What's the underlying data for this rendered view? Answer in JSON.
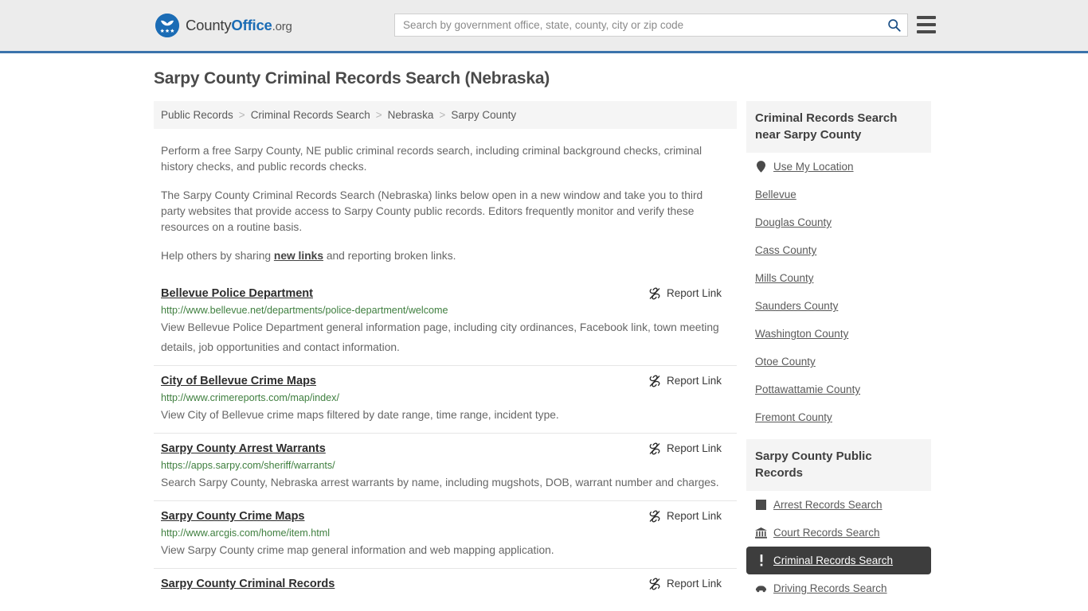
{
  "header": {
    "logo_text_part1": "County",
    "logo_text_part2": "Office",
    "logo_text_part3": ".org",
    "search_placeholder": "Search by government office, state, county, city or zip code",
    "search_value": "",
    "search_icon": "search-icon",
    "menu_icon": "hamburger-menu-icon"
  },
  "page_title": "Sarpy County Criminal Records Search (Nebraska)",
  "breadcrumb": {
    "separator": ">",
    "items": [
      {
        "label": "Public Records"
      },
      {
        "label": "Criminal Records Search"
      },
      {
        "label": "Nebraska"
      },
      {
        "label": "Sarpy County"
      }
    ]
  },
  "intro": {
    "p1": "Perform a free Sarpy County, NE public criminal records search, including criminal background checks, criminal history checks, and public records checks.",
    "p2": "The Sarpy County Criminal Records Search (Nebraska) links below open in a new window and take you to third party websites that provide access to Sarpy County public records. Editors frequently monitor and verify these resources on a routine basis.",
    "p3_before": "Help others by sharing ",
    "p3_link": "new links",
    "p3_after": " and reporting broken links."
  },
  "report_link_label": "Report Link",
  "report_link_icon": "broken-link-icon",
  "results": [
    {
      "title": "Bellevue Police Department",
      "url": "http://www.bellevue.net/departments/police-department/welcome",
      "description": "View Bellevue Police Department general information page, including city ordinances, Facebook link, town meeting details, job opportunities and contact information."
    },
    {
      "title": "City of Bellevue Crime Maps",
      "url": "http://www.crimereports.com/map/index/",
      "description": "View City of Bellevue crime maps filtered by date range, time range, incident type."
    },
    {
      "title": "Sarpy County Arrest Warrants",
      "url": "https://apps.sarpy.com/sheriff/warrants/",
      "description": "Search Sarpy County, Nebraska arrest warrants by name, including mugshots, DOB, warrant number and charges."
    },
    {
      "title": "Sarpy County Crime Maps",
      "url": "http://www.arcgis.com/home/item.html",
      "description": "View Sarpy County crime map general information and web mapping application."
    },
    {
      "title": "Sarpy County Criminal Records",
      "url": "",
      "description": ""
    }
  ],
  "sidebar": {
    "nearby": {
      "title": "Criminal Records Search near Sarpy County",
      "items": [
        {
          "label": "Use My Location",
          "icon": "map-pin-icon",
          "active": false
        },
        {
          "label": "Bellevue",
          "icon": "",
          "active": false
        },
        {
          "label": "Douglas County",
          "icon": "",
          "active": false
        },
        {
          "label": "Cass County",
          "icon": "",
          "active": false
        },
        {
          "label": "Mills County",
          "icon": "",
          "active": false
        },
        {
          "label": "Saunders County",
          "icon": "",
          "active": false
        },
        {
          "label": "Washington County",
          "icon": "",
          "active": false
        },
        {
          "label": "Otoe County",
          "icon": "",
          "active": false
        },
        {
          "label": "Pottawattamie County",
          "icon": "",
          "active": false
        },
        {
          "label": "Fremont County",
          "icon": "",
          "active": false
        }
      ]
    },
    "public_records": {
      "title": "Sarpy County Public Records",
      "items": [
        {
          "label": "Arrest Records Search",
          "icon": "fingerprint-icon",
          "active": false
        },
        {
          "label": "Court Records Search",
          "icon": "courthouse-icon",
          "active": false
        },
        {
          "label": "Criminal Records Search",
          "icon": "exclamation-icon",
          "active": true
        },
        {
          "label": "Driving Records Search",
          "icon": "car-icon",
          "active": false
        }
      ]
    }
  },
  "colors": {
    "brand_blue": "#1b6cb5",
    "header_bg": "#ececec",
    "header_border": "#3b73ab",
    "url_green": "#3f7f3f",
    "active_bg": "#3d3d3d",
    "panel_bg": "#f4f4f4"
  }
}
